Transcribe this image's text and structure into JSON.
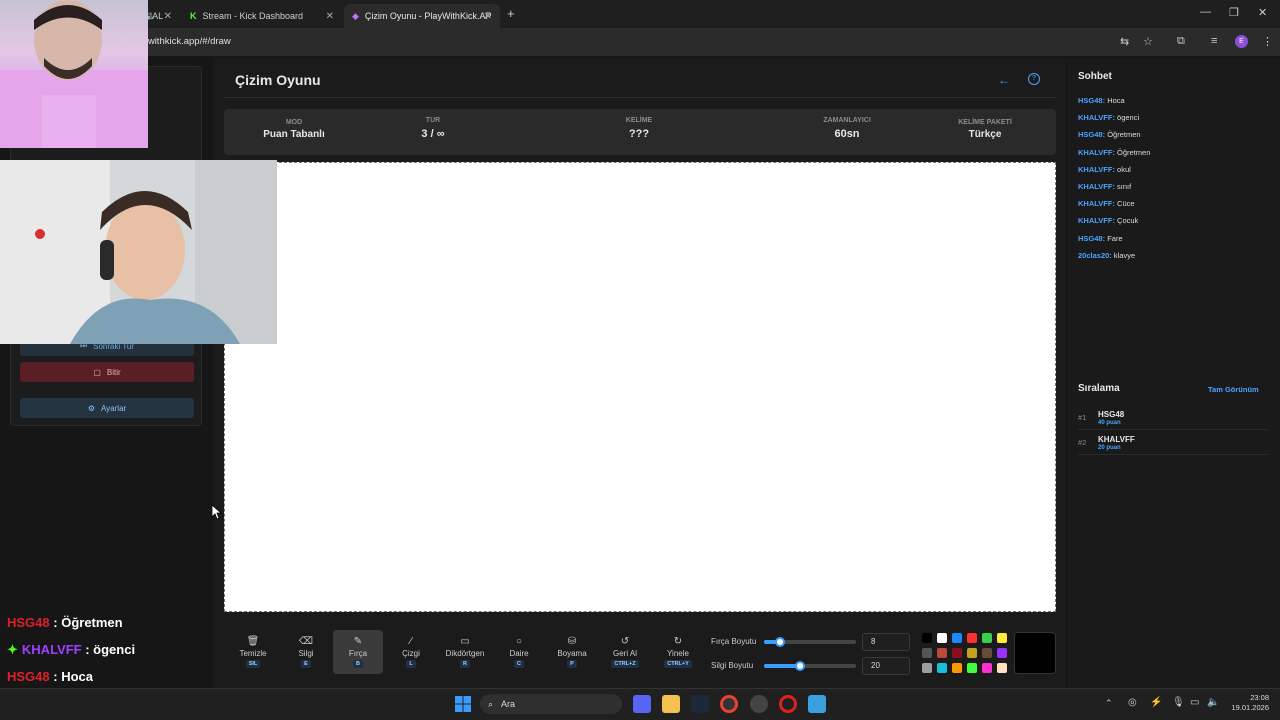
{
  "browser": {
    "tabs": [
      {
        "label": "BAY (OFFICIAL"
      },
      {
        "label": "Stream - Kick Dashboard"
      },
      {
        "label": "Çizim Oyunu - PlayWithKick.AP"
      }
    ],
    "url": "demo.playwithkick.app/#/draw"
  },
  "left_panel": {
    "next_round": "Sonraki Tur",
    "finish": "Bitir",
    "settings": "Ayarlar"
  },
  "header": {
    "title": "Çizim Oyunu"
  },
  "info": {
    "mode_label": "MOD",
    "mode_value": "Puan Tabanlı",
    "round_label": "TUR",
    "round_value": "3 / ∞",
    "word_label": "KELİME",
    "word_value": "???",
    "timer_label": "ZAMANLAYICI",
    "timer_value": "60sn",
    "pack_label": "KELİME PAKETİ",
    "pack_value": "Türkçe"
  },
  "tools": [
    {
      "label": "Temizle",
      "key": "SIL",
      "icon": "trash-icon"
    },
    {
      "label": "Silgi",
      "key": "E",
      "icon": "eraser-icon"
    },
    {
      "label": "Fırça",
      "key": "B",
      "icon": "brush-icon"
    },
    {
      "label": "Çizgi",
      "key": "L",
      "icon": "line-icon"
    },
    {
      "label": "Dikdörtgen",
      "key": "R",
      "icon": "rectangle-icon"
    },
    {
      "label": "Daire",
      "key": "C",
      "icon": "circle-icon"
    },
    {
      "label": "Boyama",
      "key": "P",
      "icon": "bucket-icon"
    },
    {
      "label": "Geri Al",
      "key": "CTRL+Z",
      "icon": "undo-icon"
    },
    {
      "label": "Yinele",
      "key": "CTRL+Y",
      "icon": "redo-icon"
    }
  ],
  "brush": {
    "brush_size_label": "Fırça Boyutu",
    "brush_size": "8",
    "eraser_size_label": "Silgi Boyutu",
    "eraser_size": "20"
  },
  "palette": [
    "#000000",
    "#ffffff",
    "#1e88ff",
    "#ff3030",
    "#3ccf4e",
    "#ffeb3b",
    "#555555",
    "#b94a3a",
    "#8a1020",
    "#c8a020",
    "#6a4a3a",
    "#9b30ff",
    "#9e9e9e",
    "#17c0d8",
    "#ff9800",
    "#40ff40",
    "#ff30d0",
    "#ffe0c0"
  ],
  "chat": {
    "title": "Sohbet",
    "messages": [
      {
        "user": "HSG48",
        "text": "Hoca"
      },
      {
        "user": "KHALVFF",
        "text": "ögenci"
      },
      {
        "user": "HSG48",
        "text": "Öğretmen"
      },
      {
        "user": "KHALVFF",
        "text": "Öğretmen"
      },
      {
        "user": "KHALVFF",
        "text": "okul"
      },
      {
        "user": "KHALVFF",
        "text": "sınıf"
      },
      {
        "user": "KHALVFF",
        "text": "Cüce"
      },
      {
        "user": "KHALVFF",
        "text": "Çocuk"
      },
      {
        "user": "HSG48",
        "text": "Fare"
      },
      {
        "user": "20clas20",
        "text": "klavye"
      }
    ]
  },
  "ranking": {
    "title": "Sıralama",
    "full_view": "Tam Görünüm",
    "entries": [
      {
        "rank": "#1",
        "name": "HSG48",
        "points": "40 puan"
      },
      {
        "rank": "#2",
        "name": "KHALVFF",
        "points": "20 puan"
      }
    ]
  },
  "overlay_chat": [
    {
      "user": "HSG48",
      "text": "Öğretmen",
      "color": "#e0202a"
    },
    {
      "user": "KHALVFF",
      "text": "ögenci",
      "color": "#a040ff"
    },
    {
      "user": "HSG48",
      "text": "Hoca",
      "color": "#e0202a"
    }
  ],
  "taskbar": {
    "search": "Ara",
    "time": "23:08",
    "date": "19.01.2026"
  }
}
